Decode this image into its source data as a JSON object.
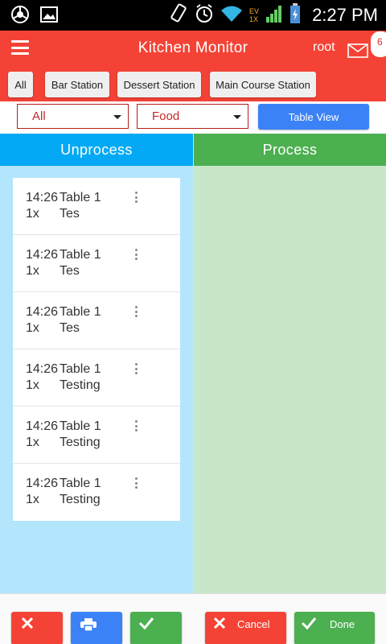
{
  "status_bar": {
    "time": "2:27 PM",
    "network_label_top": "EV",
    "network_label_bottom": "1X"
  },
  "app_bar": {
    "title": "Kitchen Monitor",
    "user": "root",
    "notification_count": "6"
  },
  "stations": [
    {
      "label": "All"
    },
    {
      "label": "Bar Station"
    },
    {
      "label": "Dessert Station"
    },
    {
      "label": "Main Course Station"
    }
  ],
  "filters": {
    "status_select": "All",
    "category_select": "Food",
    "table_view_label": "Table View"
  },
  "columns": {
    "unprocess_title": "Unprocess",
    "process_title": "Process"
  },
  "orders": [
    {
      "time": "14:26",
      "table": "Table 1",
      "qty": "1x",
      "item": "Tes"
    },
    {
      "time": "14:26",
      "table": "Table 1",
      "qty": "1x",
      "item": "Tes"
    },
    {
      "time": "14:26",
      "table": "Table 1",
      "qty": "1x",
      "item": "Tes"
    },
    {
      "time": "14:26",
      "table": "Table 1",
      "qty": "1x",
      "item": "Testing"
    },
    {
      "time": "14:26",
      "table": "Table 1",
      "qty": "1x",
      "item": "Testing"
    },
    {
      "time": "14:26",
      "table": "Table 1",
      "qty": "1x",
      "item": "Testing"
    }
  ],
  "bottom": {
    "cancel_label": "Cancel",
    "done_label": "Done"
  },
  "colors": {
    "app_bar": "#f44336",
    "unprocess_header": "#03a9f4",
    "unprocess_bg": "#b3e5fc",
    "process_header": "#4caf50",
    "process_bg": "#c8e6c9",
    "primary_button": "#3b82f6"
  }
}
